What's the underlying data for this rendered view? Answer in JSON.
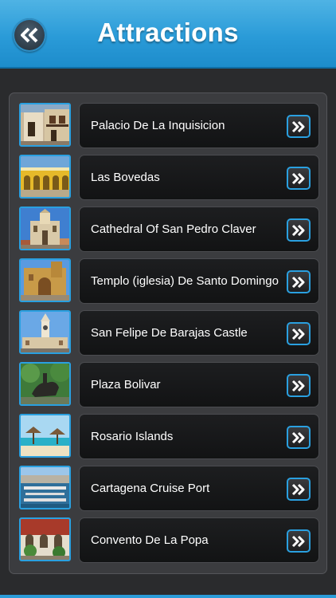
{
  "header": {
    "title": "Attractions"
  },
  "items": [
    {
      "label": "Palacio De La Inquisicion",
      "thumb": "colonial-balconies"
    },
    {
      "label": "Las Bovedas",
      "thumb": "yellow-arcade"
    },
    {
      "label": "Cathedral Of San Pedro Claver",
      "thumb": "church-facade"
    },
    {
      "label": "Templo (iglesia) De Santo Domingo",
      "thumb": "ochre-church"
    },
    {
      "label": "San Felipe De Barajas Castle",
      "thumb": "clock-tower"
    },
    {
      "label": "Plaza Bolivar",
      "thumb": "equestrian-statue"
    },
    {
      "label": "Rosario Islands",
      "thumb": "beach-huts"
    },
    {
      "label": "Cartagena Cruise Port",
      "thumb": "marina"
    },
    {
      "label": "Convento De La Popa",
      "thumb": "convent-courtyard"
    }
  ],
  "colors": {
    "accent": "#2aa0e0",
    "header": "#2a9bd8",
    "panel": "#3b3c3f",
    "cell": "#1a1b1d"
  }
}
